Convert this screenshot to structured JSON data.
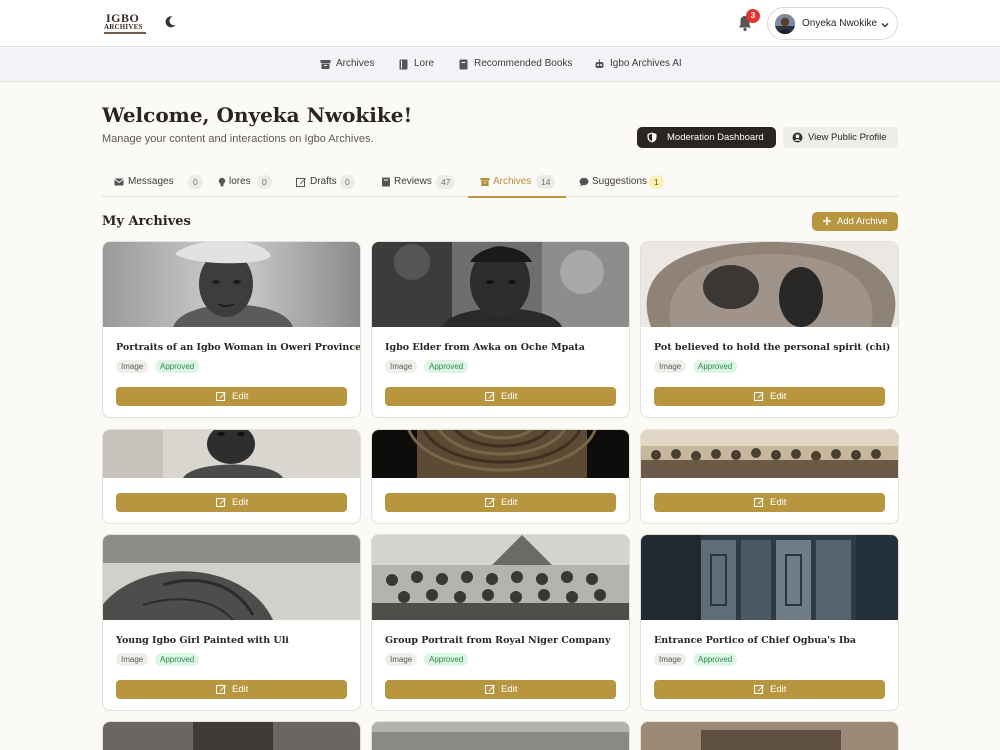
{
  "header": {
    "logo_line1": "IGBO",
    "logo_line2": "ARCHIVES",
    "notification_count": "3",
    "user_name": "Onyeka Nwokike"
  },
  "subnav": [
    {
      "label": "Archives",
      "icon": "archive-box-icon"
    },
    {
      "label": "Lore",
      "icon": "book-icon"
    },
    {
      "label": "Recommended Books",
      "icon": "book-icon"
    },
    {
      "label": "Igbo Archives AI",
      "icon": "robot-icon"
    }
  ],
  "welcome": {
    "title": "Welcome, Onyeka Nwokike!",
    "subtitle": "Manage your content and interactions on Igbo Archives.",
    "moderation_label": "Moderation Dashboard",
    "public_profile_label": "View Public Profile"
  },
  "tabs": [
    {
      "label": "Messages",
      "count": "0"
    },
    {
      "label": "lores",
      "count": "0"
    },
    {
      "label": "Drafts",
      "count": "0"
    },
    {
      "label": "Reviews",
      "count": "47"
    },
    {
      "label": "Archives",
      "count": "14"
    },
    {
      "label": "Suggestions",
      "count": "1"
    }
  ],
  "section": {
    "title": "My Archives",
    "add_label": "Add Archive"
  },
  "cards": [
    {
      "title": "Portraits of an Igbo Woman in Oweri Province",
      "type": "Image",
      "status": "Approved",
      "edit": "Edit"
    },
    {
      "title": "Igbo Elder from Awka on Oche Mpata",
      "type": "Image",
      "status": "Approved",
      "edit": "Edit"
    },
    {
      "title": "Pot believed to hold the personal spirit (chi)",
      "type": "Image",
      "status": "Approved",
      "edit": "Edit"
    },
    {
      "title": "",
      "type": "",
      "status": "",
      "edit": "Edit"
    },
    {
      "title": "",
      "type": "",
      "status": "",
      "edit": "Edit"
    },
    {
      "title": "",
      "type": "",
      "status": "",
      "edit": "Edit"
    },
    {
      "title": "Young Igbo Girl Painted with Uli",
      "type": "Image",
      "status": "Approved",
      "edit": "Edit"
    },
    {
      "title": "Group Portrait from Royal Niger Company",
      "type": "Image",
      "status": "Approved",
      "edit": "Edit"
    },
    {
      "title": "Entrance Portico of Chief Ogbua's Iba",
      "type": "Image",
      "status": "Approved",
      "edit": "Edit"
    }
  ],
  "colors": {
    "accent": "#b8963f",
    "dark_button": "#2c2420",
    "approved_bg": "#dcf5e4",
    "approved_text": "#2f8a4c",
    "badge": "#e3342f"
  }
}
